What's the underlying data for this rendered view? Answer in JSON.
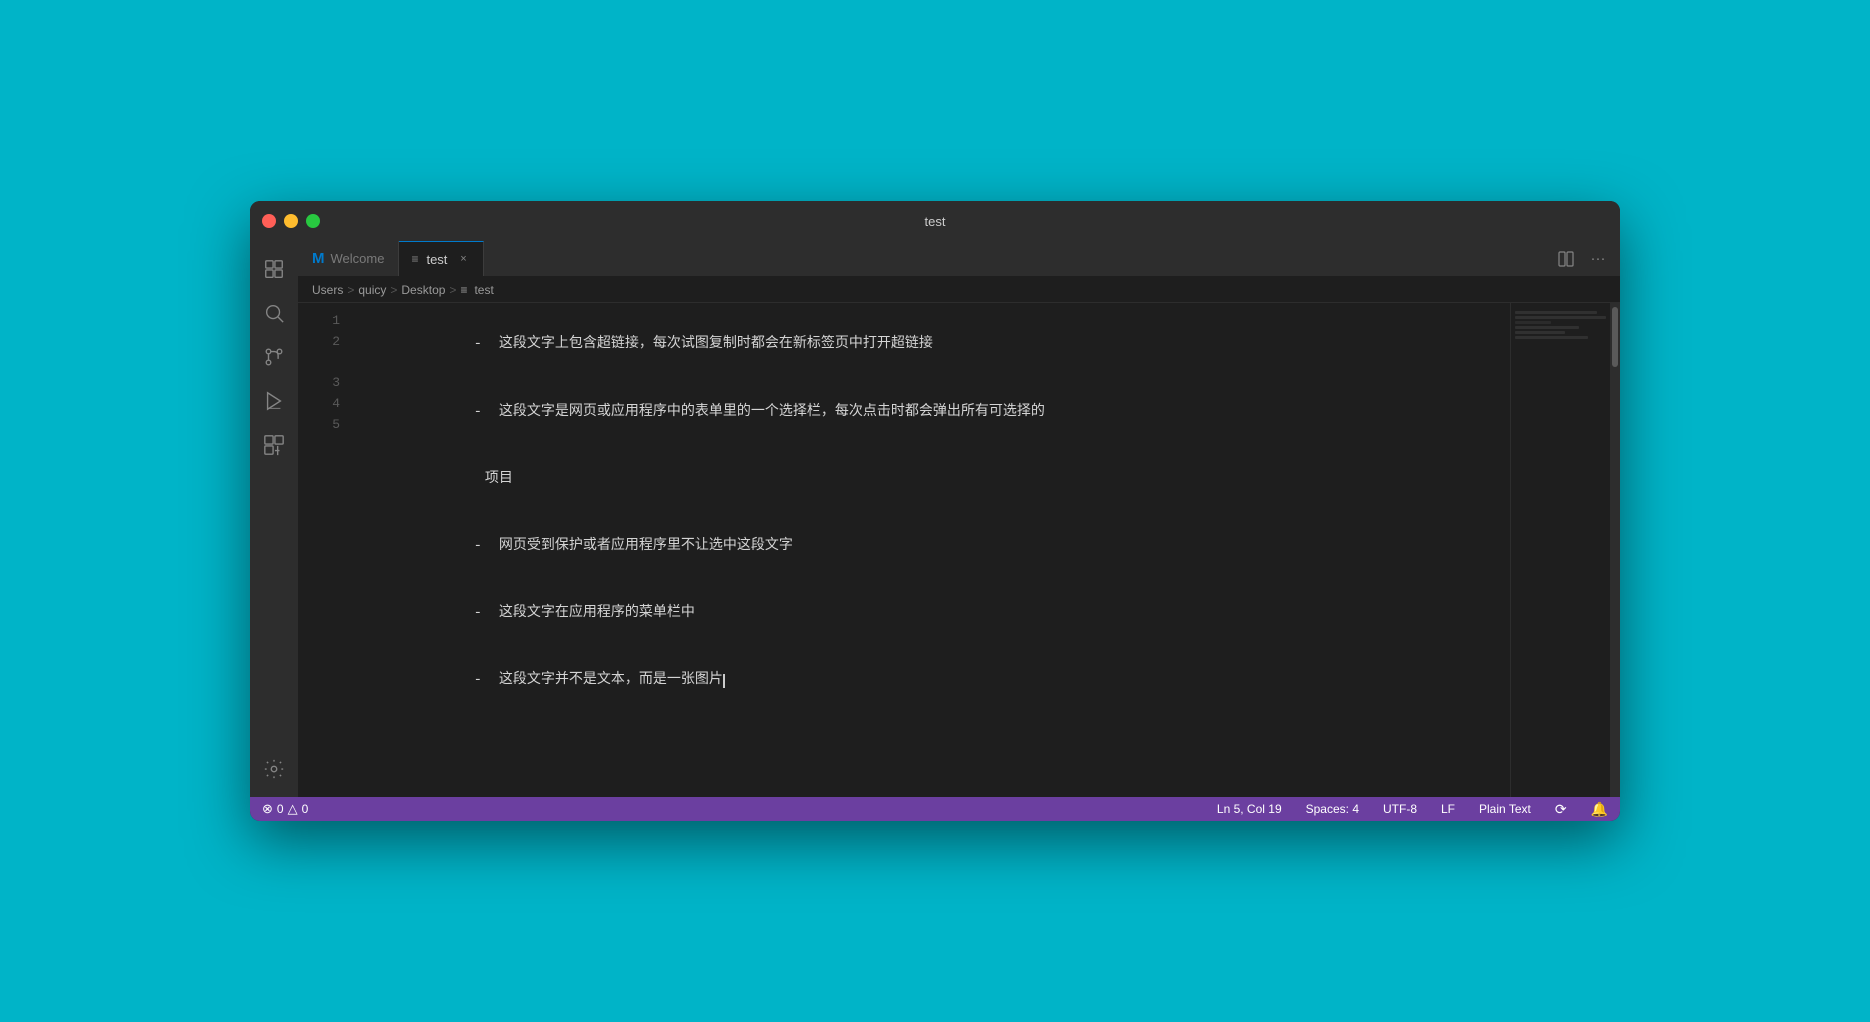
{
  "window": {
    "title": "test",
    "background_color": "#00b4c8"
  },
  "title_bar": {
    "title": "test",
    "traffic_lights": {
      "red": "red-button",
      "yellow": "yellow-button",
      "green": "green-button"
    }
  },
  "activity_bar": {
    "icons": [
      {
        "name": "explorer-icon",
        "symbol": "⎘",
        "tooltip": "Explorer"
      },
      {
        "name": "search-icon",
        "symbol": "🔍",
        "tooltip": "Search"
      },
      {
        "name": "source-control-icon",
        "symbol": "⎇",
        "tooltip": "Source Control"
      },
      {
        "name": "run-debug-icon",
        "symbol": "▷",
        "tooltip": "Run and Debug"
      },
      {
        "name": "extensions-icon",
        "symbol": "⊞",
        "tooltip": "Extensions"
      }
    ],
    "bottom_icons": [
      {
        "name": "settings-icon",
        "symbol": "⚙",
        "tooltip": "Settings"
      }
    ]
  },
  "tab_bar": {
    "welcome_tab": {
      "label": "Welcome",
      "logo": "M"
    },
    "active_tab": {
      "label": "test",
      "close_button": "×"
    },
    "actions": [
      {
        "name": "split-editor-icon",
        "symbol": "⧉"
      },
      {
        "name": "more-actions-icon",
        "symbol": "…"
      }
    ]
  },
  "breadcrumb": {
    "items": [
      "Users",
      "quicy",
      "Desktop",
      "test"
    ],
    "separators": [
      ">",
      ">",
      ">"
    ]
  },
  "editor": {
    "lines": [
      {
        "number": "1",
        "content": "  -  这段文字上包含超链接，每次试图复制时都会在新标签页中打开超链接"
      },
      {
        "number": "2",
        "content": "  -  这段文字是网页或应用程序中的表单里的一个选择栏，每次点击时都会弹出所有可选择的\n项目"
      },
      {
        "number": "3",
        "content": "  -  网页受到保护或者应用程序里不让选中这段文字"
      },
      {
        "number": "4",
        "content": "  -  这段文字在应用程序的菜单栏中"
      },
      {
        "number": "5",
        "content": "  -  这段文字并不是文本，而是一张图片",
        "has_cursor": true
      }
    ]
  },
  "status_bar": {
    "errors": "0",
    "warnings": "0",
    "error_label": "0",
    "warning_label": "0",
    "position": "Ln 5, Col 19",
    "spaces": "Spaces: 4",
    "encoding": "UTF-8",
    "line_ending": "LF",
    "language": "Plain Text",
    "sync_icon": "sync",
    "bell_icon": "bell",
    "background_color": "#6b3fa0"
  }
}
